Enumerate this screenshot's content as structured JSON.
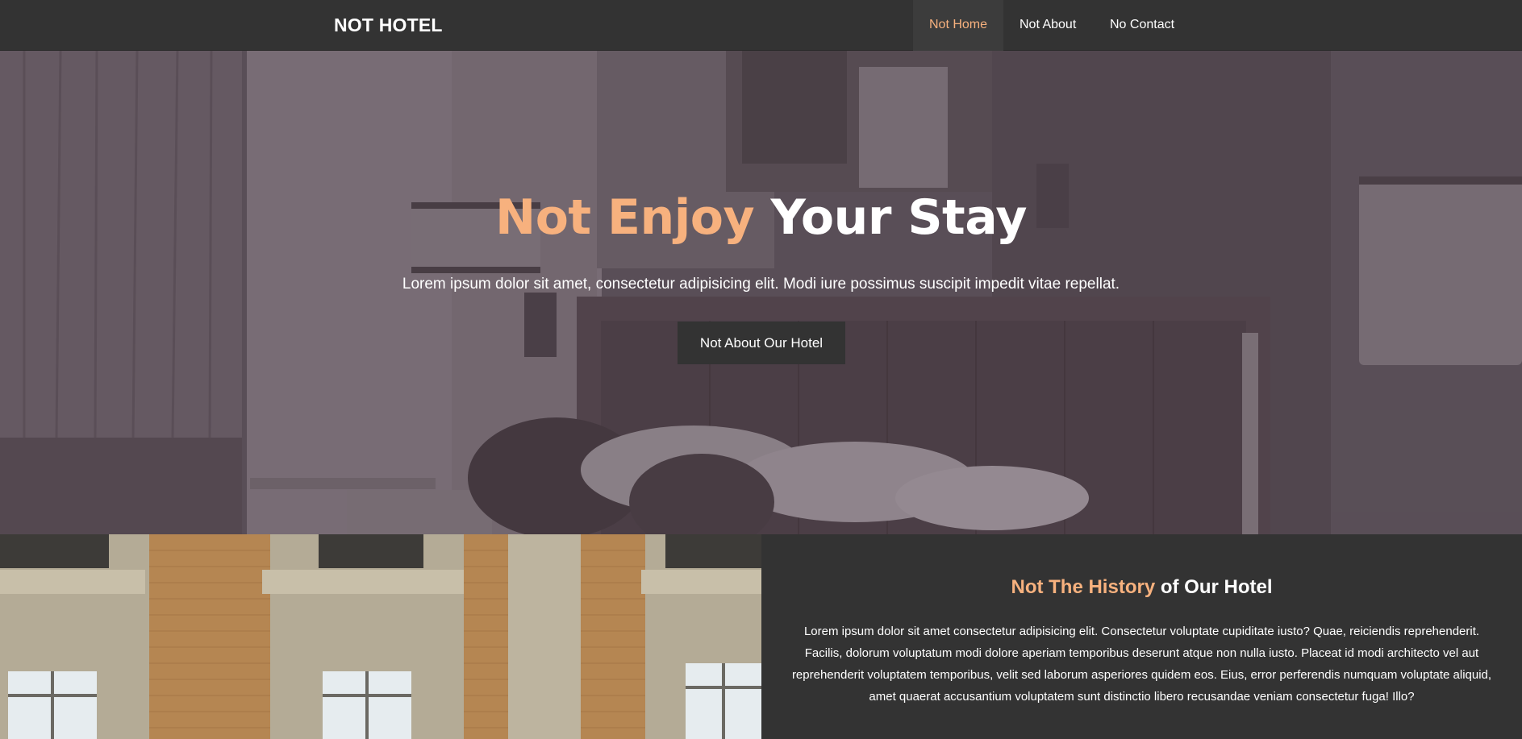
{
  "nav": {
    "brand": "NOT HOTEL",
    "items": [
      {
        "label": "Not Home",
        "active": true
      },
      {
        "label": "Not About",
        "active": false
      },
      {
        "label": "No Contact",
        "active": false
      }
    ]
  },
  "hero": {
    "title_accent": "Not Enjoy",
    "title_rest": "Your Stay",
    "subtitle": "Lorem ipsum dolor sit amet, consectetur adipisicing elit. Modi iure possimus suscipit impedit vitae repellat.",
    "button_label": "Not About Our Hotel"
  },
  "history": {
    "title_accent": "Not The History",
    "title_rest": "of Our Hotel",
    "body": "Lorem ipsum dolor sit amet consectetur adipisicing elit. Consectetur voluptate cupiditate iusto? Quae, reiciendis reprehenderit. Facilis, dolorum voluptatum modi dolore aperiam temporibus deserunt atque non nulla iusto. Placeat id modi architecto vel aut reprehenderit voluptatem temporibus, velit sed laborum asperiores quidem eos. Eius, error perferendis numquam voluptate aliquid, amet quaerat accusantium voluptatem sunt distinctio libero recusandae veniam consectetur fuga! Illo?"
  },
  "colors": {
    "accent": "#f7b17e",
    "dark": "#333333"
  }
}
